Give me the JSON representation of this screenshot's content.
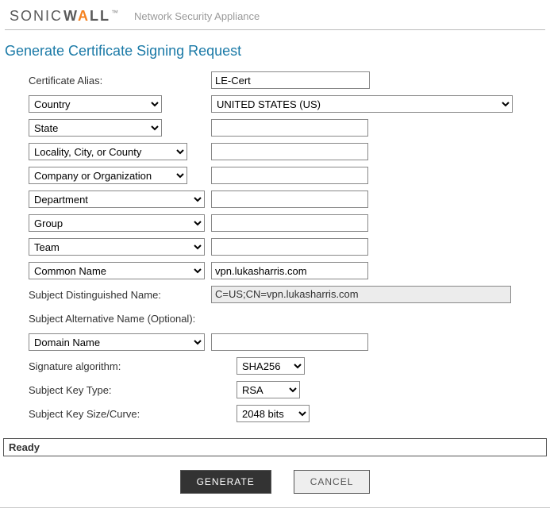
{
  "header": {
    "logo_sonic": "SONIC",
    "logo_wall_pre": "W",
    "logo_wall_accent": "A",
    "logo_wall_post": "LL",
    "tm": "™",
    "subtitle": "Network Security Appliance"
  },
  "title": "Generate Certificate Signing Request",
  "form": {
    "alias_label": "Certificate Alias:",
    "alias_value": "LE-Cert",
    "country_option": "Country",
    "country_value": "UNITED STATES (US)",
    "state_option": "State",
    "state_value": "",
    "locality_option": "Locality, City, or County",
    "locality_value": "",
    "company_option": "Company or Organization",
    "company_value": "",
    "department_option": "Department",
    "department_value": "",
    "group_option": "Group",
    "group_value": "",
    "team_option": "Team",
    "team_value": "",
    "cn_option": "Common Name",
    "cn_value": "vpn.lukasharris.com",
    "sdn_label": "Subject Distinguished Name:",
    "sdn_value": "C=US;CN=vpn.lukasharris.com",
    "san_label": "Subject Alternative Name (Optional):",
    "san_option": "Domain Name",
    "san_value": "",
    "sig_label": "Signature algorithm:",
    "sig_value": "SHA256",
    "keytype_label": "Subject Key Type:",
    "keytype_value": "RSA",
    "keysize_label": "Subject Key Size/Curve:",
    "keysize_value": "2048 bits"
  },
  "status": "Ready",
  "buttons": {
    "generate": "GENERATE",
    "cancel": "CANCEL"
  }
}
